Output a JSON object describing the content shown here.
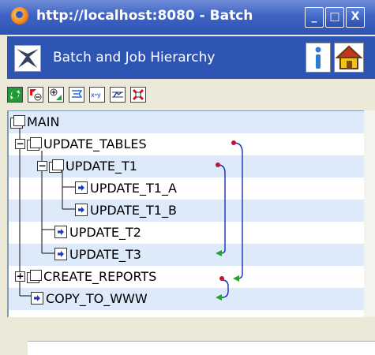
{
  "window": {
    "title": "http://localhost:8080 - Batch",
    "controls": [
      "_",
      "□",
      "X"
    ]
  },
  "header": {
    "app_title": "Batch and Job Hierarchy",
    "icons": [
      "app-logo-icon",
      "info-icon",
      "home-icon"
    ]
  },
  "toolbar": {
    "buttons": [
      "refresh-icon",
      "collapse-icon",
      "expand-icon",
      "filter-icon",
      "xy-icon",
      "schedule-icon",
      "delete-icon"
    ]
  },
  "tree": {
    "nodes": [
      {
        "label": "MAIN",
        "type": "group"
      },
      {
        "label": "UPDATE_TABLES",
        "type": "group",
        "expander": "−"
      },
      {
        "label": "UPDATE_T1",
        "type": "group",
        "expander": "−"
      },
      {
        "label": "UPDATE_T1_A",
        "type": "job"
      },
      {
        "label": "UPDATE_T1_B",
        "type": "job"
      },
      {
        "label": "UPDATE_T2",
        "type": "job"
      },
      {
        "label": "UPDATE_T3",
        "type": "job"
      },
      {
        "label": "CREATE_REPORTS",
        "type": "group",
        "expander": "+"
      },
      {
        "label": "COPY_TO_WWW",
        "type": "job"
      }
    ],
    "colors": {
      "stripe": "#dceaf9",
      "line": "#333333",
      "dependency": "#1a2fb0",
      "dep_start": "#c0143c",
      "dep_end": "#2aa12a"
    }
  }
}
